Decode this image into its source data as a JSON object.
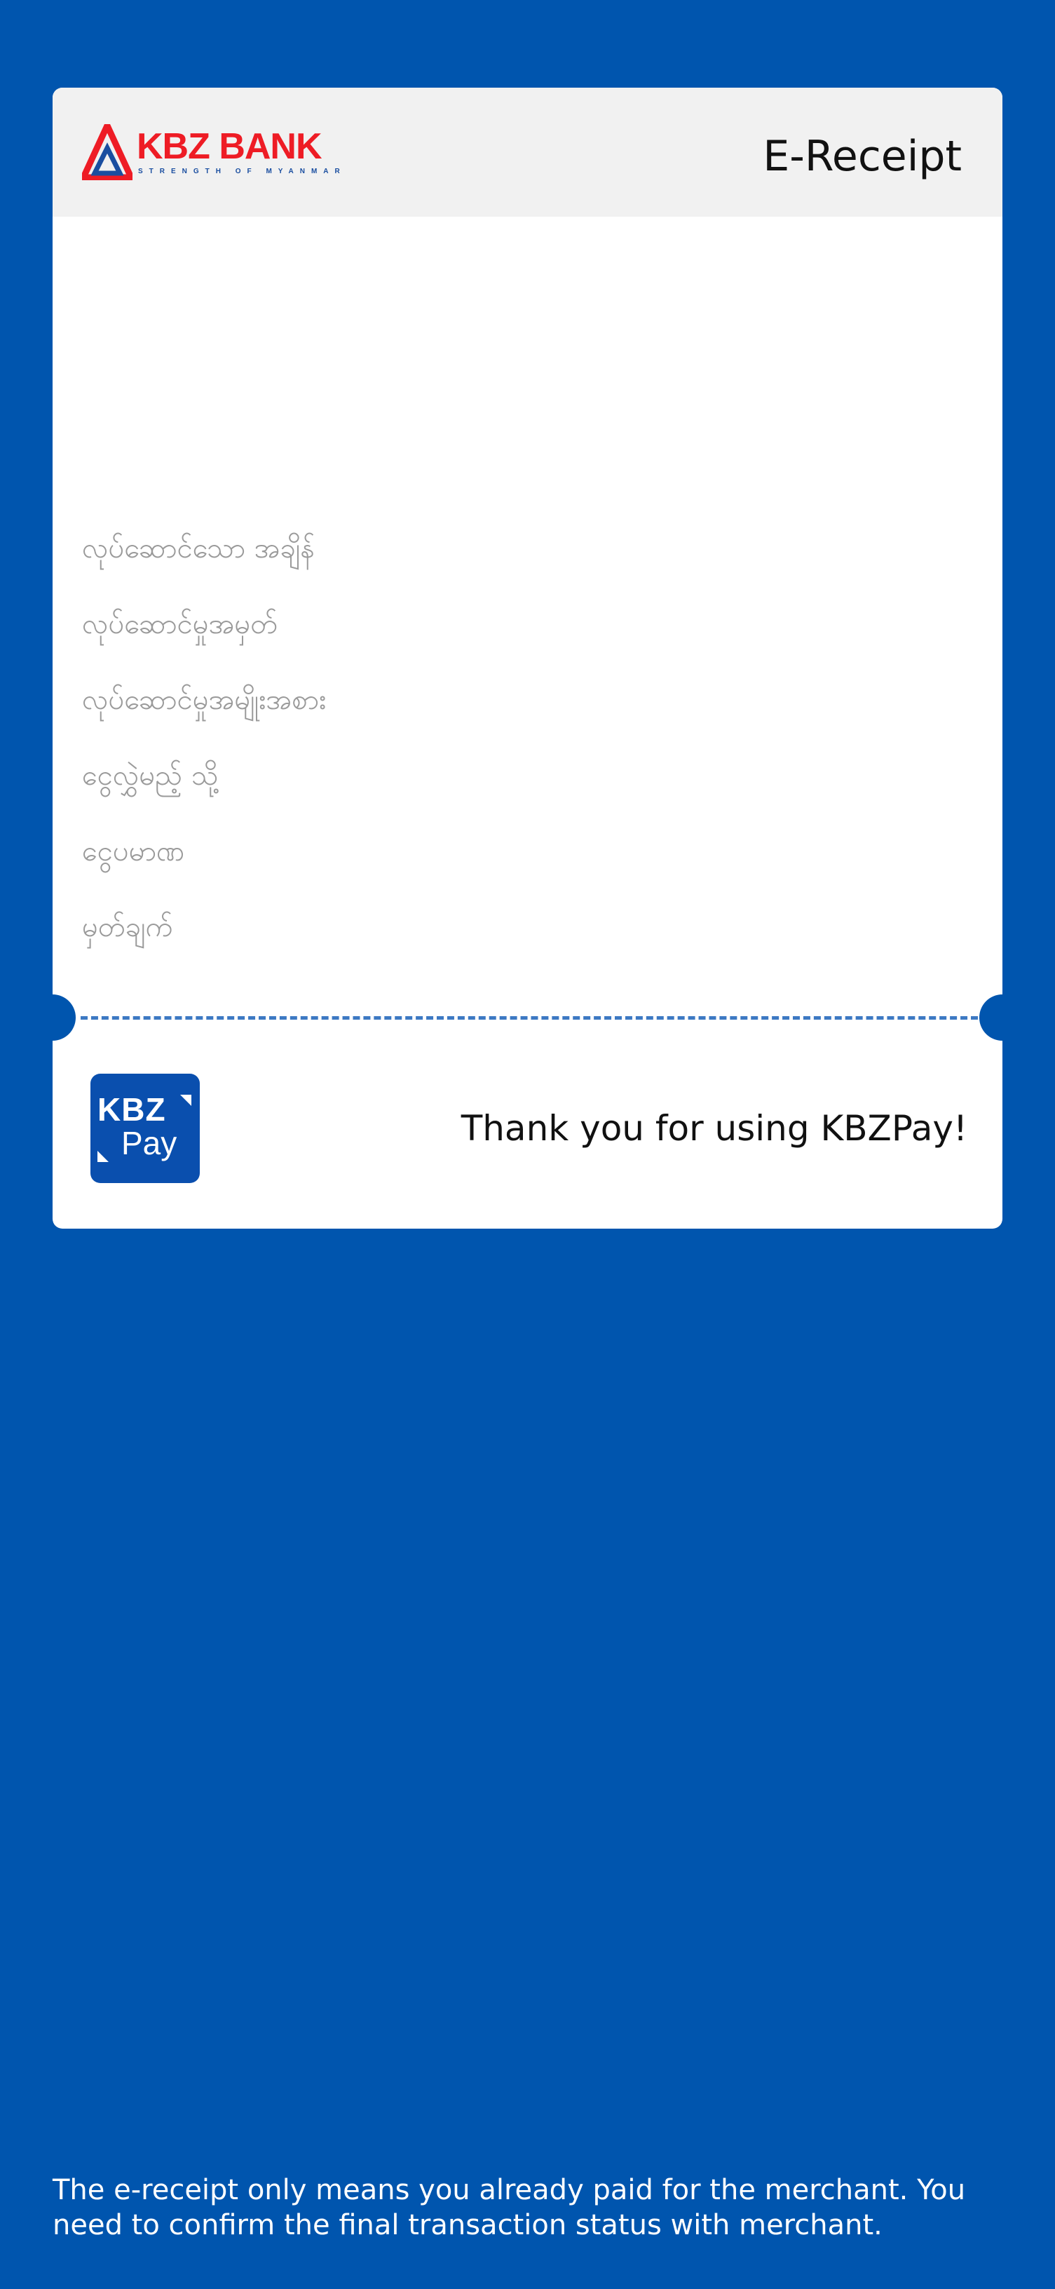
{
  "header": {
    "bank_logo": {
      "wordmark": "KBZ BANK",
      "tagline": "STRENGTH OF MYANMAR"
    },
    "title": "E-Receipt"
  },
  "fields": [
    {
      "label": "လုပ်ဆောင်သော အချိန်"
    },
    {
      "label": "လုပ်ဆောင်မှုအမှတ်"
    },
    {
      "label": "လုပ်ဆောင်မှုအမျိုးအစား"
    },
    {
      "label": "ငွေလွှဲမည့် သို့"
    },
    {
      "label": "ငွေပမာဏ"
    },
    {
      "label": "မှတ်ချက်"
    }
  ],
  "footer": {
    "pay_logo": {
      "line1": "KBZ",
      "line2": "Pay"
    },
    "thank_you": "Thank you for using KBZPay!"
  },
  "disclaimer": "The e-receipt only means you already paid for the merchant. You need to confirm the final transaction status with merchant.",
  "colors": {
    "background": "#0055ae",
    "card": "#ffffff",
    "header_bg": "#f1f1f1",
    "brand_red": "#ee1c25",
    "brand_blue": "#1a4ea0",
    "label_gray": "#9a9a9a",
    "divider": "#3d79c3"
  }
}
